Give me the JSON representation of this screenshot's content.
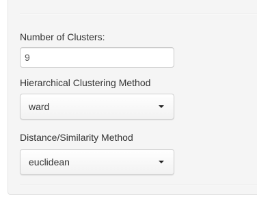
{
  "form": {
    "clusters": {
      "label": "Number of Clusters:",
      "value": "9"
    },
    "hclust_method": {
      "label": "Hierarchical Clustering Method",
      "selected": "ward"
    },
    "distance_method": {
      "label": "Distance/Similarity Method",
      "selected": "euclidean"
    }
  },
  "icons": {
    "dropdown": "caret-down-icon"
  },
  "colors": {
    "panel_bg": "#f5f5f5",
    "text": "#333333",
    "input_border": "#cccccc"
  }
}
